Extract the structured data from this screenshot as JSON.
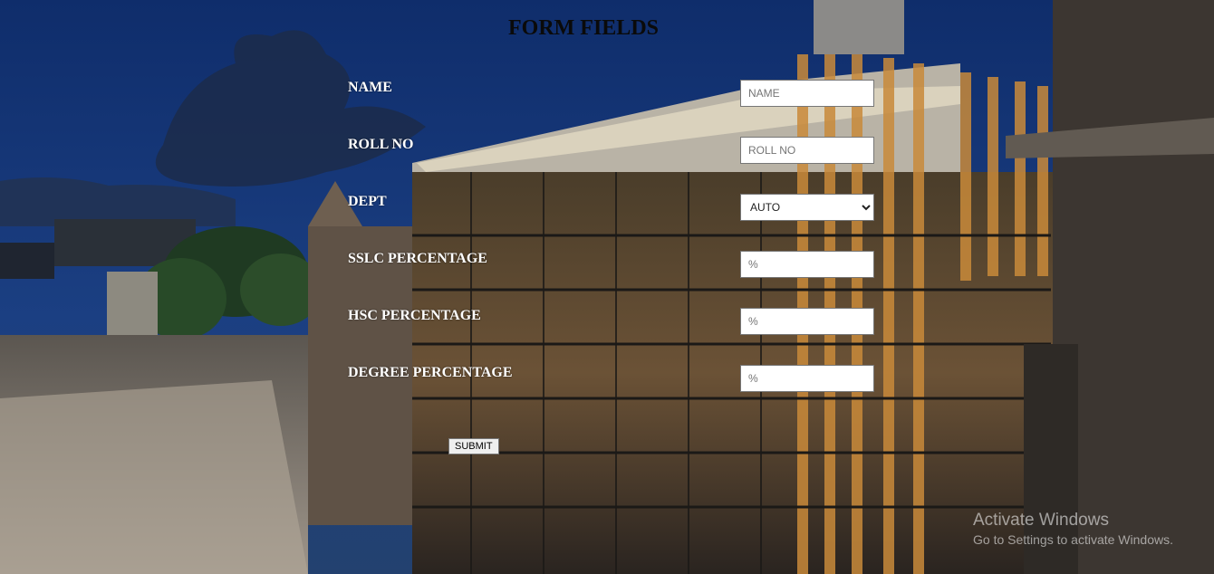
{
  "form": {
    "title": "FORM FIELDS",
    "fields": [
      {
        "label": "NAME",
        "placeholder": "NAME"
      },
      {
        "label": "ROLL NO",
        "placeholder": "ROLL NO"
      },
      {
        "label": "DEPT",
        "selected": "AUTO"
      },
      {
        "label": "SSLC PERCENTAGE",
        "placeholder": "%"
      },
      {
        "label": "HSC PERCENTAGE",
        "placeholder": "%"
      },
      {
        "label": "DEGREE PERCENTAGE",
        "placeholder": "%"
      }
    ],
    "submit_label": "SUBMIT"
  },
  "watermark": {
    "title": "Activate Windows",
    "subtitle": "Go to Settings to activate Windows."
  }
}
